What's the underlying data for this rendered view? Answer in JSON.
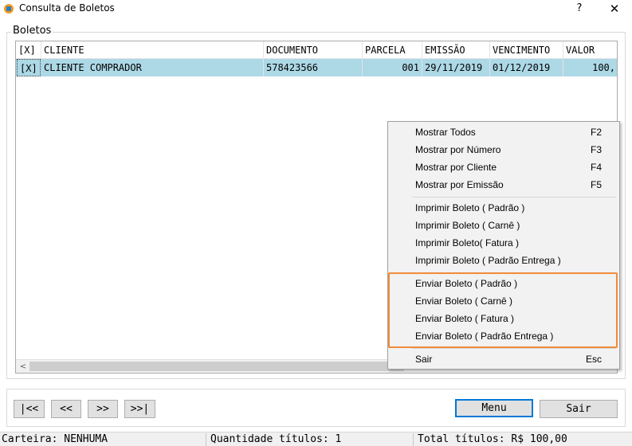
{
  "window": {
    "title": "Consulta de Boletos",
    "help_label": "?",
    "close_label": "✕"
  },
  "group": {
    "title": "Boletos"
  },
  "grid": {
    "columns": [
      "[X]",
      "CLIENTE",
      "DOCUMENTO",
      "PARCELA",
      "EMISSÃO",
      "VENCIMENTO",
      "VALOR"
    ],
    "rows": [
      {
        "check": "[X]",
        "cliente": "CLIENTE COMPRADOR",
        "documento": "578423566",
        "parcela": "001",
        "emissao": "29/11/2019",
        "vencimento": "01/12/2019",
        "valor": "100,"
      }
    ],
    "scroll_left_label": "<"
  },
  "context_menu": {
    "items": [
      {
        "label": "Mostrar Todos",
        "shortcut": "F2"
      },
      {
        "label": "Mostrar por Número",
        "shortcut": "F3"
      },
      {
        "label": "Mostrar por Cliente",
        "shortcut": "F4"
      },
      {
        "label": "Mostrar por Emissão",
        "shortcut": "F5"
      },
      {
        "label": "Imprimir Boleto ( Padrão )",
        "shortcut": ""
      },
      {
        "label": "Imprimir Boleto ( Carnê )",
        "shortcut": ""
      },
      {
        "label": "Imprimir Boleto( Fatura )",
        "shortcut": ""
      },
      {
        "label": "Imprimir Boleto ( Padrão Entrega )",
        "shortcut": ""
      },
      {
        "label": "Enviar Boleto ( Padrão )",
        "shortcut": ""
      },
      {
        "label": "Enviar Boleto ( Carnê )",
        "shortcut": ""
      },
      {
        "label": "Enviar Boleto ( Fatura )",
        "shortcut": ""
      },
      {
        "label": "Enviar Boleto ( Padrão Entrega )",
        "shortcut": ""
      },
      {
        "label": "Sair",
        "shortcut": "Esc"
      }
    ]
  },
  "buttons": {
    "first": "|<<",
    "prev": "<<",
    "next": ">>",
    "last": ">>|",
    "menu": "Menu",
    "exit": "Sair"
  },
  "status": {
    "carteira": "Carteira: NENHUMA",
    "quantidade": "Quantidade títulos: 1",
    "total": "Total títulos: R$ 100,00"
  },
  "colors": {
    "selected_row": "#add8e6",
    "highlight_border": "#f08c3a",
    "default_button_border": "#0078d7"
  }
}
